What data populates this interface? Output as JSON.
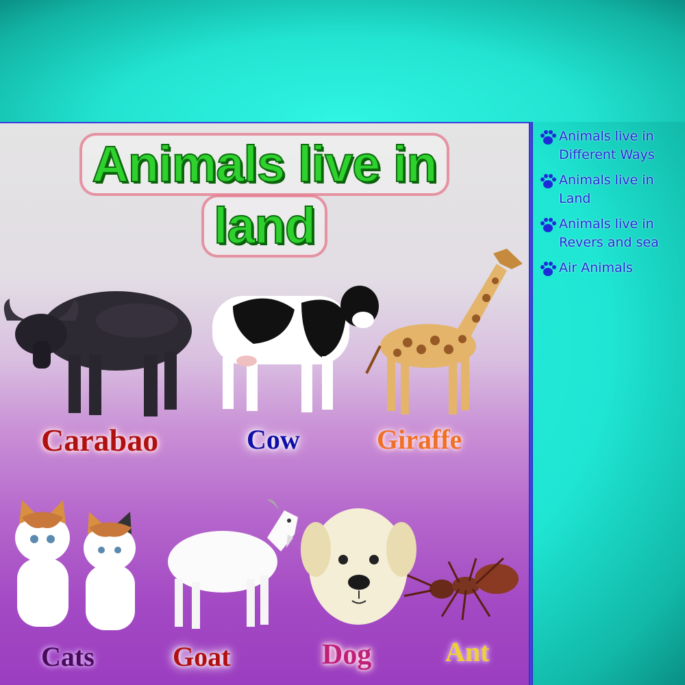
{
  "title": {
    "line1": "Animals live in",
    "line2": "land"
  },
  "animals": {
    "carabao": "Carabao",
    "cow": "Cow",
    "giraffe": "Giraffe",
    "cats": "Cats",
    "goat": "Goat",
    "dog": "Dog",
    "ant": "Ant"
  },
  "sidebar": {
    "items": [
      {
        "label": "Animals live in Different Ways",
        "icon": "paw-icon"
      },
      {
        "label": "Animals live in Land",
        "icon": "paw-icon"
      },
      {
        "label": "Animals live in Revers and sea",
        "icon": "paw-icon"
      },
      {
        "label": "Air Animals",
        "icon": "paw-icon"
      }
    ]
  },
  "colors": {
    "background": "#1fe6d3",
    "title_green": "#2ed12e",
    "sidebar_text": "#1e2bd8",
    "carabao_label": "#b01010",
    "cow_label": "#1010a8",
    "giraffe_label": "#f07028",
    "cats_label": "#4a0a5a",
    "goat_label": "#b01010",
    "dog_label": "#c0207a",
    "ant_label": "#f0d030"
  }
}
